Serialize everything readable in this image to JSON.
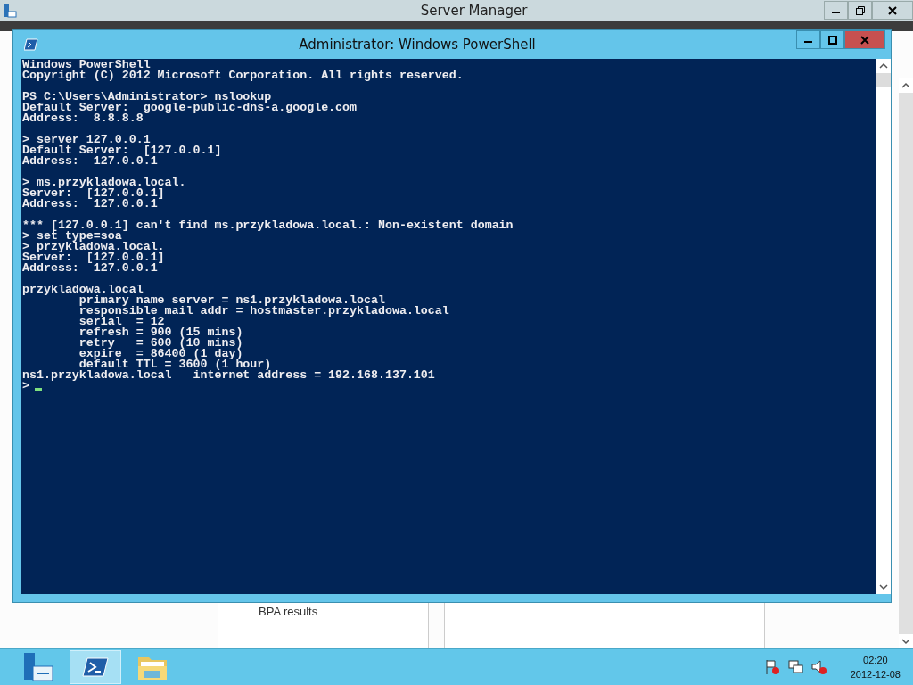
{
  "background_window": {
    "title": "Server Manager",
    "panel_text": "BPA results"
  },
  "console_window": {
    "title": "Administrator: Windows PowerShell",
    "blocks": [
      [
        "Windows PowerShell",
        "Copyright (C) 2012 Microsoft Corporation. All rights reserved."
      ],
      [
        "PS C:\\Users\\Administrator> nslookup",
        "Default Server:  google-public-dns-a.google.com",
        "Address:  8.8.8.8"
      ],
      [
        "> server 127.0.0.1",
        "Default Server:  [127.0.0.1]",
        "Address:  127.0.0.1"
      ],
      [
        "> ms.przykladowa.local.",
        "Server:  [127.0.0.1]",
        "Address:  127.0.0.1"
      ],
      [
        "*** [127.0.0.1] can't find ms.przykladowa.local.: Non-existent domain",
        "> set type=soa",
        "> przykladowa.local.",
        "Server:  [127.0.0.1]",
        "Address:  127.0.0.1"
      ],
      [
        "przykladowa.local",
        "        primary name server = ns1.przykladowa.local",
        "        responsible mail addr = hostmaster.przykladowa.local",
        "        serial  = 12",
        "        refresh = 900 (15 mins)",
        "        retry   = 600 (10 mins)",
        "        expire  = 86400 (1 day)",
        "        default TTL = 3600 (1 hour)",
        "ns1.przykladowa.local   internet address = 192.168.137.101"
      ]
    ],
    "prompt": ">"
  },
  "taskbar": {
    "apps": [
      {
        "kind": "server",
        "selected": false
      },
      {
        "kind": "powershell",
        "selected": true
      },
      {
        "kind": "folder",
        "selected": false
      }
    ],
    "clock": {
      "time": "02:20",
      "date": "2012-12-08"
    }
  }
}
